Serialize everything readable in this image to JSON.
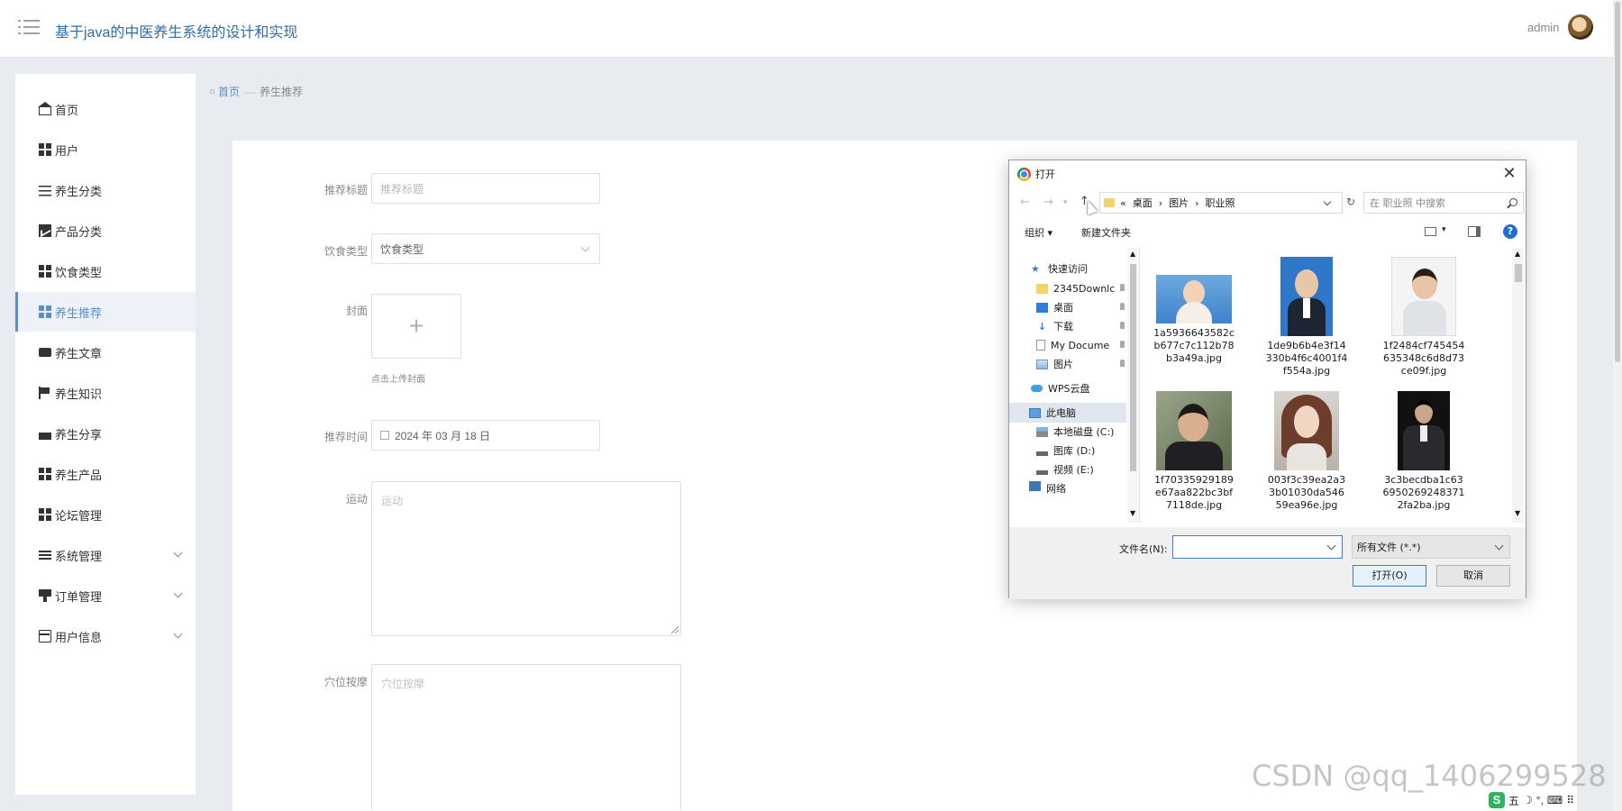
{
  "header": {
    "app_title": "基于java的中医养生系统的设计和实现",
    "user_name": "admin"
  },
  "sidebar": {
    "items": [
      {
        "label": "首页",
        "icon": "home-icon"
      },
      {
        "label": "用户",
        "icon": "grid-icon"
      },
      {
        "label": "养生分类",
        "icon": "sliders-icon"
      },
      {
        "label": "产品分类",
        "icon": "chart-icon"
      },
      {
        "label": "饮食类型",
        "icon": "grid-icon"
      },
      {
        "label": "养生推荐",
        "icon": "grid-icon",
        "active": true
      },
      {
        "label": "养生文章",
        "icon": "card-icon"
      },
      {
        "label": "养生知识",
        "icon": "flag-icon"
      },
      {
        "label": "养生分享",
        "icon": "share-icon"
      },
      {
        "label": "养生产品",
        "icon": "grid-icon"
      },
      {
        "label": "论坛管理",
        "icon": "grid-icon"
      },
      {
        "label": "系统管理",
        "icon": "list-icon",
        "expandable": true
      },
      {
        "label": "订单管理",
        "icon": "monitor-icon",
        "expandable": true
      },
      {
        "label": "用户信息",
        "icon": "form-icon",
        "expandable": true
      }
    ]
  },
  "breadcrumb": {
    "home": "首页",
    "separator": "—",
    "current": "养生推荐"
  },
  "form": {
    "title_label": "推荐标题",
    "title_placeholder": "推荐标题",
    "diet_label": "饮食类型",
    "diet_placeholder": "饮食类型",
    "cover_label": "封面",
    "cover_plus": "+",
    "cover_tip": "点击上传封面",
    "time_label": "推荐时间",
    "time_value": "2024 年 03 月 18 日",
    "exercise_label": "运动",
    "exercise_placeholder": "运动",
    "acupoint_label": "穴位按摩",
    "acupoint_placeholder": "穴位按摩"
  },
  "dialog": {
    "title": "打开",
    "close": "✕",
    "nav_back": "←",
    "nav_forward": "→",
    "nav_up": "↑",
    "path": [
      "«",
      "桌面",
      "›",
      "图片",
      "›",
      "职业照"
    ],
    "refresh": "↻",
    "search_placeholder": "在 职业照 中搜索",
    "organize": "组织 ▾",
    "new_folder": "新建文件夹",
    "view_dropdown": "▾",
    "help": "?",
    "tree": [
      {
        "label": "快速访问",
        "icon": "star-icon"
      },
      {
        "label": "2345Downlc",
        "icon": "folder-icon",
        "pinned": true
      },
      {
        "label": "桌面",
        "icon": "desktop-icon",
        "pinned": true
      },
      {
        "label": "下载",
        "icon": "download-icon",
        "pinned": true
      },
      {
        "label": "My Docume",
        "icon": "document-icon",
        "pinned": true
      },
      {
        "label": "图片",
        "icon": "pictures-icon",
        "pinned": true
      },
      {
        "label": "WPS云盘",
        "icon": "cloud-icon"
      },
      {
        "label": "此电脑",
        "icon": "computer-icon",
        "selected": true
      },
      {
        "label": "本地磁盘 (C:)",
        "icon": "disk-icon"
      },
      {
        "label": "图库 (D:)",
        "icon": "disk-icon"
      },
      {
        "label": "视频 (E:)",
        "icon": "disk-icon"
      },
      {
        "label": "网络",
        "icon": "network-icon"
      }
    ],
    "files": [
      {
        "name": [
          "1a5936643582c",
          "b677c7c112b78",
          "b3a49a.jpg"
        ]
      },
      {
        "name": [
          "1de9b6b4e3f14",
          "330b4f6c4001f4",
          "f554a.jpg"
        ]
      },
      {
        "name": [
          "1f2484cf745454",
          "635348c6d8d73",
          "ce09f.jpg"
        ]
      },
      {
        "name": [
          "1f70335929189",
          "e67aa822bc3bf",
          "7118de.jpg"
        ]
      },
      {
        "name": [
          "003f3c39ea2a3",
          "3b01030da546",
          "59ea96e.jpg"
        ]
      },
      {
        "name": [
          "3c3becdba1c63",
          "6950269248371",
          "2fa2ba.jpg"
        ]
      }
    ],
    "filename_label": "文件名(N):",
    "filetype": "所有文件 (*.*)",
    "open_button": "打开(O)",
    "cancel_button": "取消"
  },
  "watermark": "CSDN @qq_1406299528",
  "tray": {
    "logo": "S",
    "ime": "五",
    "moon": "☽",
    "punct": "°,",
    "keyboard": "⌨",
    "more": "⠿"
  },
  "colors": {
    "accent": "#5b8fc7",
    "title_blue": "#2d6ea8",
    "background": "#e8ebef"
  }
}
